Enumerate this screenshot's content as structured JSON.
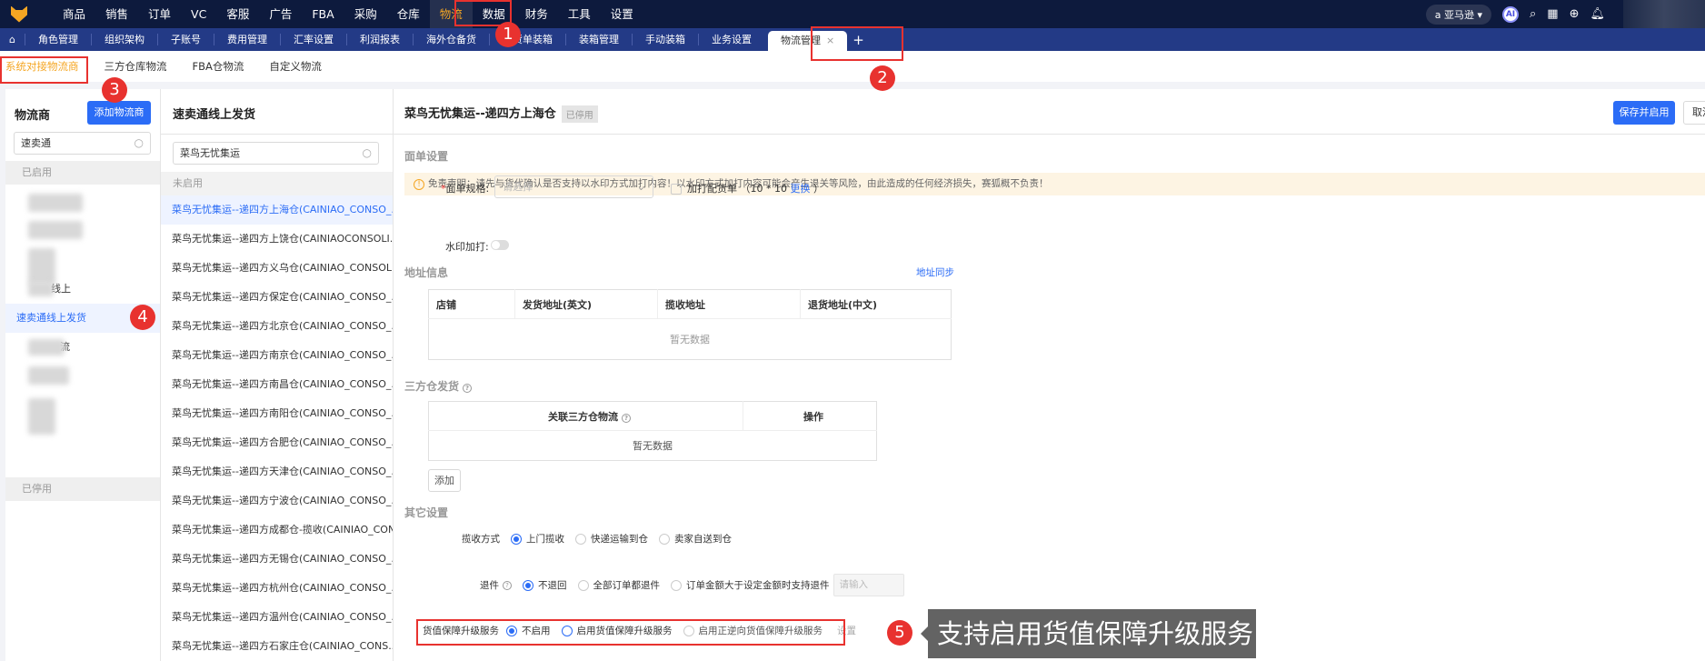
{
  "topnav": {
    "items": [
      "商品",
      "销售",
      "订单",
      "VC",
      "客服",
      "广告",
      "FBA",
      "采购",
      "仓库",
      "物流",
      "数据",
      "财务",
      "工具",
      "设置"
    ],
    "active": "物流",
    "store": "亚马逊",
    "ai": "AI"
  },
  "tabbar": {
    "items": [
      "角色管理",
      "组织架构",
      "子账号",
      "费用管理",
      "汇率设置",
      "利润报表",
      "海外仓备货",
      "备货单装箱",
      "装箱管理",
      "手动装箱",
      "业务设置"
    ],
    "active": "物流管理",
    "close": "×",
    "add": "+"
  },
  "subtabs": [
    "系统对接物流商",
    "三方仓库物流",
    "FBA仓物流",
    "自定义物流"
  ],
  "left": {
    "title": "物流商",
    "add_button": "添加物流商",
    "search_value": "速卖通",
    "enabled_header": "已启用",
    "partial_item": "线上",
    "selected_item": "速卖通线上发货",
    "partial_item2": "流",
    "disabled_header": "已停用"
  },
  "mid": {
    "title": "速卖通线上发货",
    "search_value": "菜鸟无忧集运",
    "group_header": "未启用",
    "items": [
      "菜鸟无忧集运--递四方上海仓(CAINIAO_CONSO_...",
      "菜鸟无忧集运--递四方上饶仓(CAINIAOCONSOLI...",
      "菜鸟无忧集运--递四方义乌仓(CAINIAO_CONSOLI...",
      "菜鸟无忧集运--递四方保定仓(CAINIAO_CONSO_...",
      "菜鸟无忧集运--递四方北京仓(CAINIAO_CONSO_...",
      "菜鸟无忧集运--递四方南京仓(CAINIAO_CONSO_...",
      "菜鸟无忧集运--递四方南昌仓(CAINIAO_CONSO_...",
      "菜鸟无忧集运--递四方南阳仓(CAINIAO_CONSO_...",
      "菜鸟无忧集运--递四方合肥仓(CAINIAO_CONSO_...",
      "菜鸟无忧集运--递四方天津仓(CAINIAO_CONSO_...",
      "菜鸟无忧集运--递四方宁波仓(CAINIAO_CONSO_...",
      "菜鸟无忧集运--递四方成都仓-揽收(CAINIAO_CON...",
      "菜鸟无忧集运--递四方无锡仓(CAINIAO_CONSO_...",
      "菜鸟无忧集运--递四方杭州仓(CAINIAO_CONSO_...",
      "菜鸟无忧集运--递四方温州仓(CAINIAO_CONSO_...",
      "菜鸟无忧集运--递四方石家庄仓(CAINIAO_CONS..."
    ]
  },
  "right": {
    "title": "菜鸟无忧集运--递四方上海仓",
    "status": "已停用",
    "save_button": "保存并启用",
    "cancel_button": "取消",
    "sec_label": "面单设置",
    "warning": "免责声明：请先与货代确认是否支持以水印方式加打内容！以水印方式加打内容可能会产生退关等风险，由此造成的任何经济损失，赛狐概不负责！",
    "spec_label": "面单规格:",
    "spec_placeholder": "请选择",
    "print_pick": "加打配货单",
    "size": "（10 * 10",
    "change": "更换",
    "size_end": "）",
    "watermark_label": "水印加打:",
    "addr_title": "地址信息",
    "addr_sync": "地址同步",
    "addr_cols": [
      "店铺",
      "发货地址(英文)",
      "揽收地址",
      "退货地址(中文)"
    ],
    "empty": "暂无数据",
    "tpw_title": "三方仓发货",
    "tpw_cols": [
      "关联三方仓物流",
      "操作"
    ],
    "add_button": "添加",
    "other_title": "其它设置",
    "pickup_label": "揽收方式",
    "pickup_options": [
      "上门揽收",
      "快递运输到仓",
      "卖家自送到仓"
    ],
    "return_label": "退件",
    "return_options": [
      "不退回",
      "全部订单都退件",
      "订单金额大于设定金额时支持退件"
    ],
    "return_placeholder": "请输入",
    "insure_label": "货值保障升级服务",
    "insure_options": [
      "不启用",
      "启用货值保障升级服务",
      "启用正逆向货值保障升级服务"
    ],
    "insure_setting": "设置"
  },
  "annotations": {
    "n1": "1",
    "n2": "2",
    "n3": "3",
    "n4": "4",
    "n5": "5",
    "callout": "支持启用货值保障升级服务"
  },
  "colors": {
    "primary": "#2b6cf6",
    "nav": "#0d1a3d",
    "tabbar": "#233a86",
    "accent": "#f5a623",
    "annotation": "#e8322f"
  }
}
